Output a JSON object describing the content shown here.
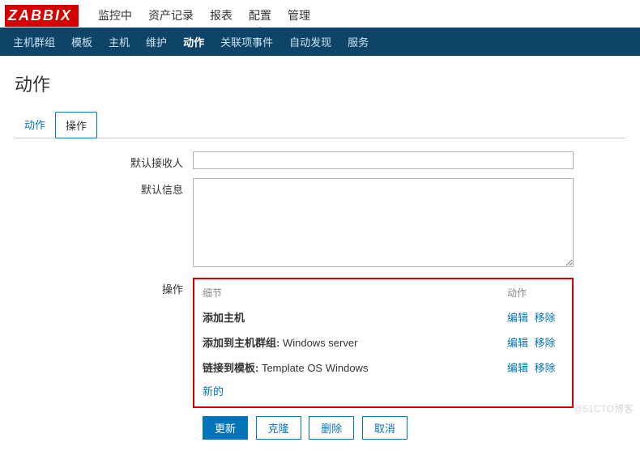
{
  "logo": "ZABBIX",
  "topnav": {
    "items": [
      "监控中",
      "资产记录",
      "报表",
      "配置",
      "管理"
    ],
    "active": 3
  },
  "subnav": {
    "items": [
      "主机群组",
      "模板",
      "主机",
      "维护",
      "动作",
      "关联项事件",
      "自动发现",
      "服务"
    ],
    "active": 4
  },
  "page_title": "动作",
  "tabs": {
    "items": [
      "动作",
      "操作"
    ],
    "active": 1
  },
  "form": {
    "recipient_label": "默认接收人",
    "recipient_value": "",
    "message_label": "默认信息",
    "message_value": "",
    "ops_label": "操作",
    "ops_head_detail": "细节",
    "ops_head_action": "动作",
    "ops": [
      {
        "text": "添加主机"
      },
      {
        "prefix": "添加到主机群组: ",
        "value": "Windows server"
      },
      {
        "prefix": "链接到模板: ",
        "value": "Template OS Windows"
      }
    ],
    "edit_label": "编辑",
    "remove_label": "移除",
    "new_label": "新的"
  },
  "buttons": {
    "update": "更新",
    "clone": "克隆",
    "delete": "删除",
    "cancel": "取消"
  },
  "watermark": "@51CTO博客"
}
